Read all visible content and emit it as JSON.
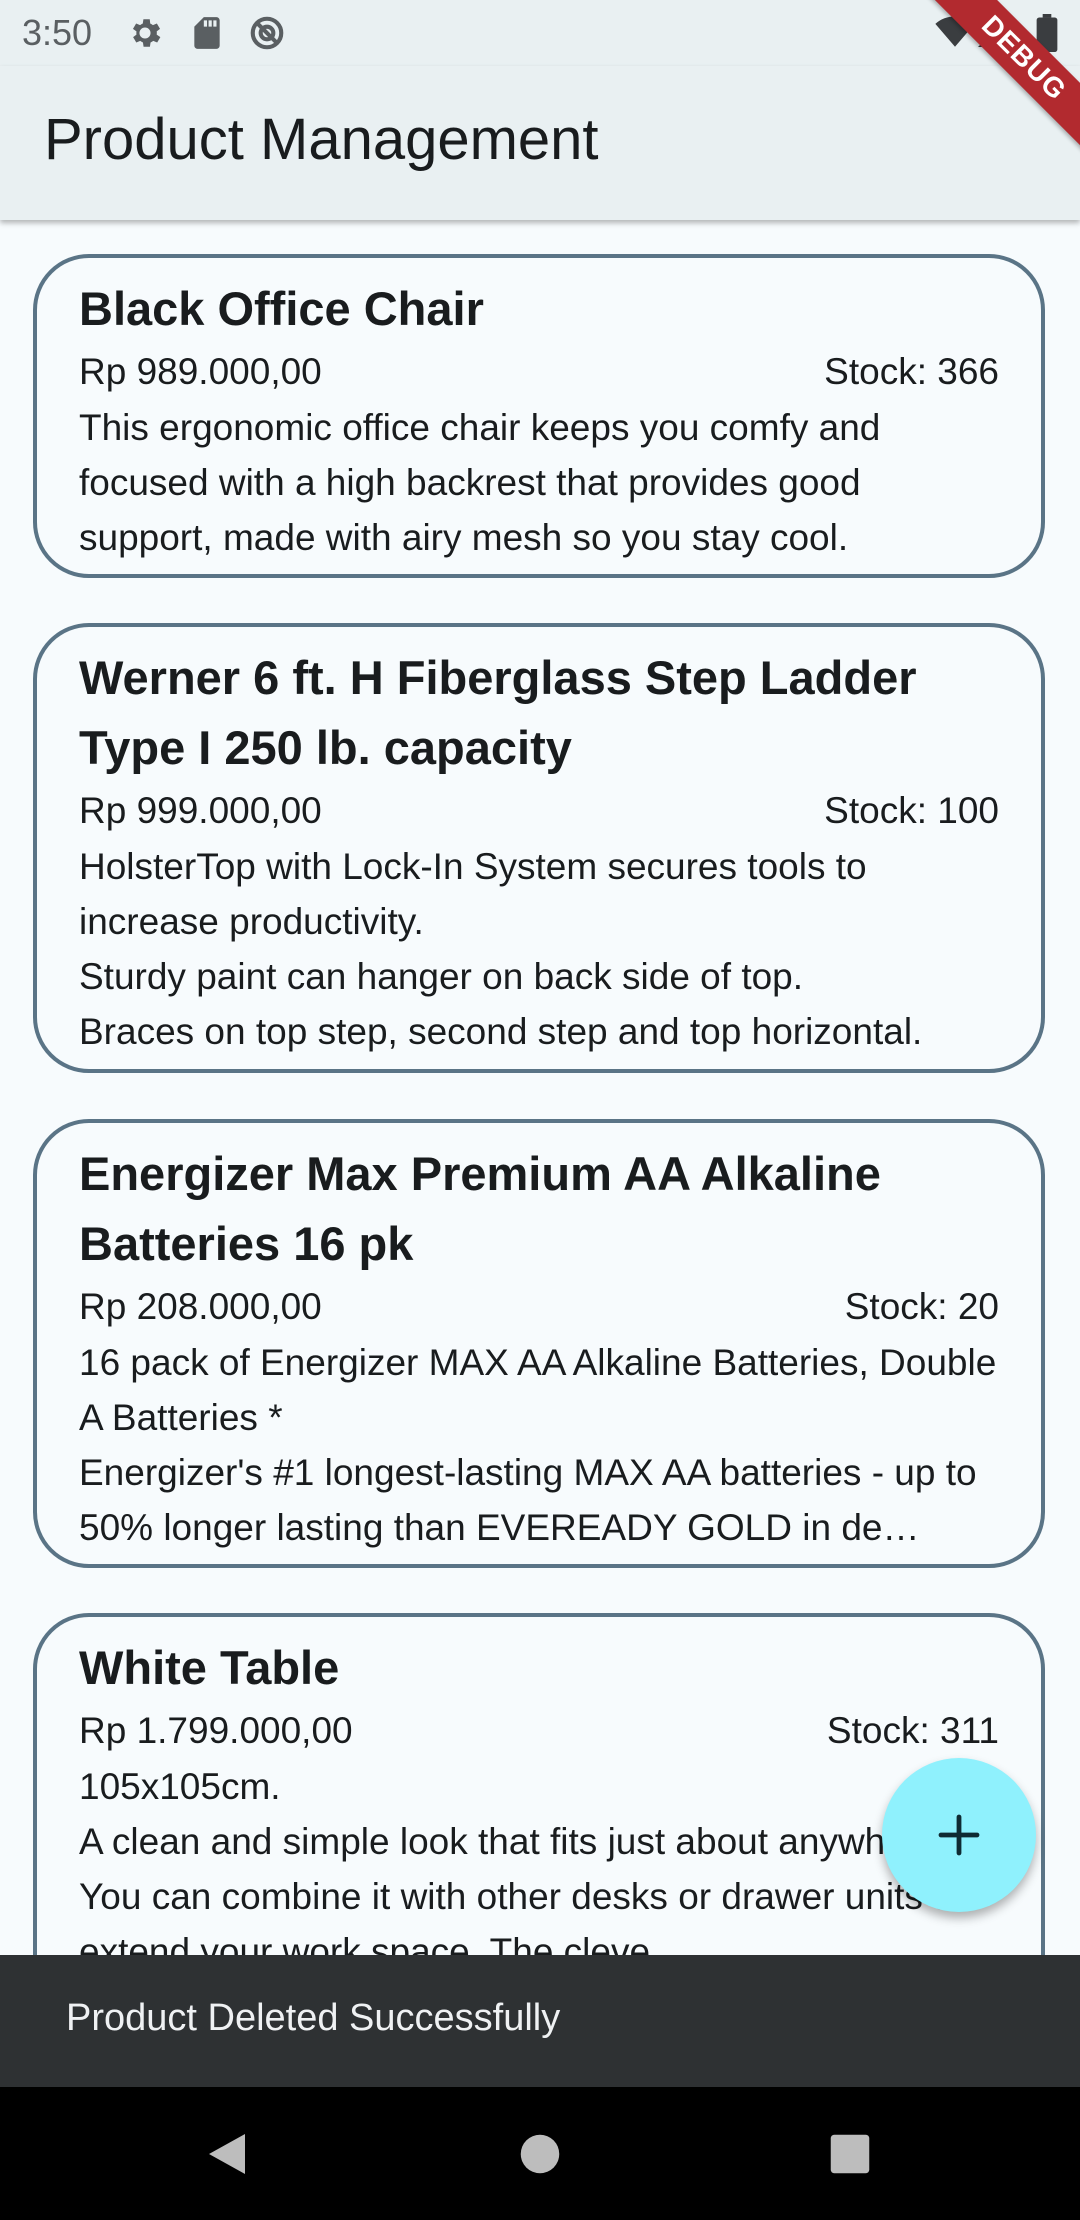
{
  "status_bar": {
    "time": "3:50",
    "left_icons": [
      "settings-gear-icon",
      "sd-card-icon",
      "data-saver-icon"
    ],
    "right_icons": [
      "wifi-icon",
      "cellular-signal-icon",
      "battery-icon"
    ]
  },
  "debug_banner": {
    "label": "DEBUG",
    "color": "#b22a2f"
  },
  "app_bar": {
    "title": "Product Management"
  },
  "products": [
    {
      "name": "Black Office Chair",
      "price": "Rp 989.000,00",
      "stock": "Stock: 366",
      "description": "This ergonomic office chair keeps you comfy and focused with a high backrest that provides good support, made with airy mesh so you stay cool."
    },
    {
      "name": "Werner 6 ft. H Fiberglass Step Ladder Type I 250 lb. capacity",
      "price": "Rp 999.000,00",
      "stock": "Stock: 100",
      "description": "HolsterTop with Lock-In System secures tools to increase productivity.\nSturdy paint can hanger on back side of top.\nBraces on top step, second step and top horizontal."
    },
    {
      "name": "Energizer Max Premium AA Alkaline Batteries 16 pk",
      "price": "Rp 208.000,00",
      "stock": "Stock: 20",
      "description": "16 pack of Energizer MAX AA Alkaline Batteries, Double A Batteries *\nEnergizer's #1 longest-lasting MAX AA batteries - up to 50% longer lasting than EVEREADY GOLD in de…"
    },
    {
      "name": "White Table",
      "price": "Rp 1.799.000,00",
      "stock": "Stock: 311",
      "description": "105x105cm.\nA clean and simple look that fits just about anywhere. You can combine it with other desks or drawer units to extend your work space. The cleve"
    }
  ],
  "fab": {
    "icon": "plus-icon",
    "color": "#8ff1fd"
  },
  "snackbar": {
    "message": "Product Deleted Successfully"
  },
  "nav_bar": {
    "buttons": [
      "back-icon",
      "home-icon",
      "recents-icon"
    ]
  },
  "colors": {
    "app_bar_bg": "#e9f0f2",
    "card_border": "#5a7486",
    "background": "#f7fbfd",
    "snackbar_bg": "#2e3133"
  }
}
